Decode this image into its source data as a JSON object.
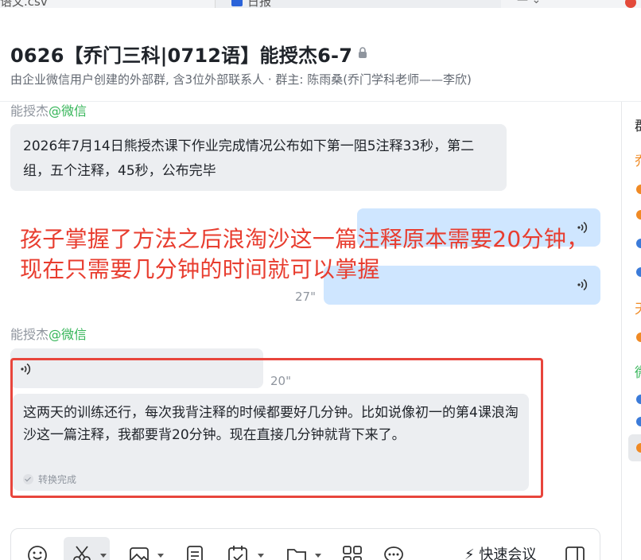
{
  "tabs": {
    "left_label": "语文.csv",
    "right_label": "日报"
  },
  "header": {
    "title": "0626【乔门三科|0712语】能授杰6-7",
    "subtitle": "由企业微信用户创建的外部群, 含3位外部联系人 · 群主: 陈雨桑(乔门学科老师——李欣)"
  },
  "messages": {
    "m1": {
      "sender_name": "能授杰",
      "sender_source": "@微信",
      "text": "2026年7月14日熊授杰课下作业完成情况公布如下第一阻5注释33秒，第二组，五个注释，45秒，公布完毕"
    },
    "m2": {
      "voice_duration": "27\""
    },
    "m3": {
      "sender_name": "能授杰",
      "sender_source": "@微信",
      "voice_duration": "20\"",
      "transcript": "这两天的训练还行，每次我背注释的时候都要好几分钟。比如说像初一的第4课浪淘沙这一篇注释，我都要背20分钟。现在直接几分钟就背下来了。",
      "status": "转换完成"
    }
  },
  "annotation": {
    "text": "孩子掌握了方法之后浪淘沙这一篇注释原本需要20分钟，现在只需要几分钟的时间就可以掌握"
  },
  "right_panel": {
    "title": "群"
  },
  "toolbar": {
    "quick_meeting": "快速会议"
  },
  "colors": {
    "annotation_red": "#e83d2f",
    "wechat_green": "#35b558",
    "bubble_blue": "#cfe6ff",
    "bubble_gray": "#eceef1"
  }
}
